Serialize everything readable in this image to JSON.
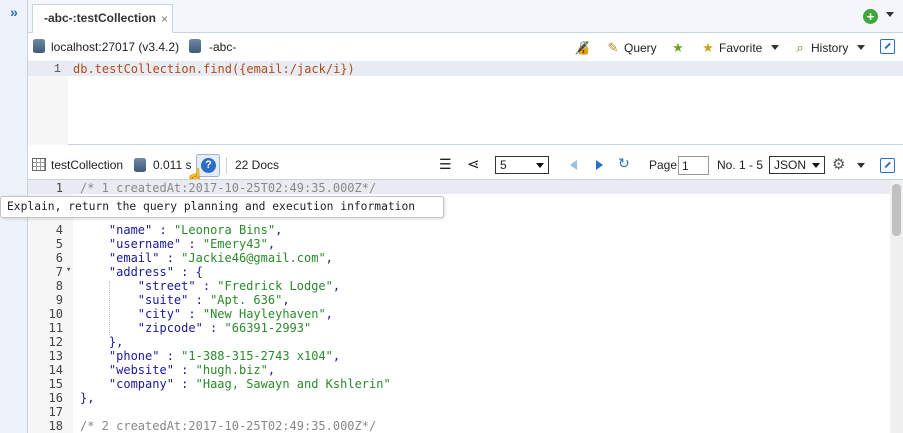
{
  "sidebar": {
    "expand_icon": "double-chevron-right-icon",
    "expand_glyph": "»"
  },
  "tabs": [
    {
      "label": "-abc-:testCollection",
      "close_glyph": "×"
    }
  ],
  "tab_actions": {
    "add_icon": "plus-circle-icon",
    "add_glyph": "+",
    "add_color": "#3ea83a"
  },
  "connection": {
    "server": "localhost:27017 (v3.4.2)",
    "database": "-abc-"
  },
  "toolbar": {
    "query_label": "Query",
    "favorite_label": "Favorite",
    "history_label": "History"
  },
  "editor": {
    "line_number": "1",
    "code": "db.testCollection.find({email:/jack/i})"
  },
  "result_toolbar": {
    "collection": "testCollection",
    "elapsed": "0.011 s",
    "docs_count": "22 Docs",
    "page_size": "5",
    "page_label": "Page",
    "page_value": "1",
    "range_label": "No. 1 - 5",
    "view_mode": "JSON"
  },
  "tooltip": "Explain, return the query planning and execution information",
  "result_lines": [
    {
      "n": "1",
      "text": "/* 1 createdAt:2017-10-25T02:49:35.000Z*/",
      "kind": "comment"
    },
    {
      "n": "4",
      "text": "    \"name\" : \"Leonora Bins\",",
      "kind": "kv"
    },
    {
      "n": "5",
      "text": "    \"username\" : \"Emery43\",",
      "kind": "kv"
    },
    {
      "n": "6",
      "text": "    \"email\" : \"Jackie46@gmail.com\",",
      "kind": "kv"
    },
    {
      "n": "7",
      "text": "    \"address\" : {",
      "kind": "kv"
    },
    {
      "n": "8",
      "text": "        \"street\" : \"Fredrick Lodge\",",
      "kind": "kv"
    },
    {
      "n": "9",
      "text": "        \"suite\" : \"Apt. 636\",",
      "kind": "kv"
    },
    {
      "n": "10",
      "text": "        \"city\" : \"New Hayleyhaven\",",
      "kind": "kv"
    },
    {
      "n": "11",
      "text": "        \"zipcode\" : \"66391-2993\"",
      "kind": "kv"
    },
    {
      "n": "12",
      "text": "    },",
      "kind": "kv"
    },
    {
      "n": "13",
      "text": "    \"phone\" : \"1-388-315-2743 x104\",",
      "kind": "kv"
    },
    {
      "n": "14",
      "text": "    \"website\" : \"hugh.biz\",",
      "kind": "kv"
    },
    {
      "n": "15",
      "text": "    \"company\" : \"Haag, Sawayn and Kshlerin\"",
      "kind": "kv"
    },
    {
      "n": "16",
      "text": "},",
      "kind": "kv"
    },
    {
      "n": "17",
      "text": "",
      "kind": "kv"
    },
    {
      "n": "18",
      "text": "/* 2 createdAt:2017-10-25T02:49:35.000Z*/",
      "kind": "comment"
    }
  ],
  "colors": {
    "accent": "#2a6fc9",
    "json_key": "#1a1a99",
    "json_string": "#2a8a2a",
    "comment": "#888888"
  }
}
